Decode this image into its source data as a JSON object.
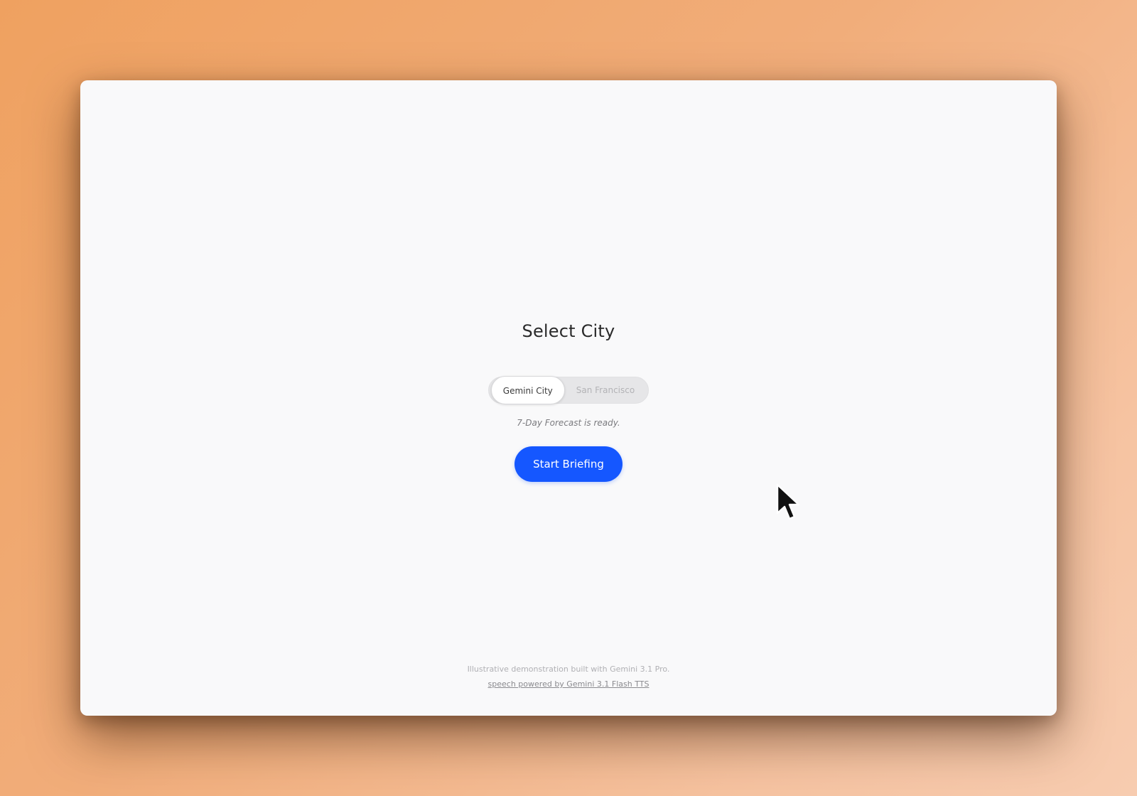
{
  "window": {
    "title": "Select City",
    "city_toggle": {
      "options": [
        "Gemini City",
        "San Francisco"
      ],
      "selected": "Gemini City"
    },
    "status_text": "7-Day Forecast is ready.",
    "primary_button_label": "Start Briefing",
    "footer": {
      "line1": "Illustrative demonstration built with Gemini 3.1 Pro.",
      "link_text": "speech powered by Gemini 3.1 Flash TTS"
    }
  },
  "colors": {
    "accent": "#1557ff",
    "window_bg": "#f9f9fa",
    "backdrop": "#efa160"
  },
  "icons": {
    "cursor": "mouse-pointer-arrow"
  }
}
